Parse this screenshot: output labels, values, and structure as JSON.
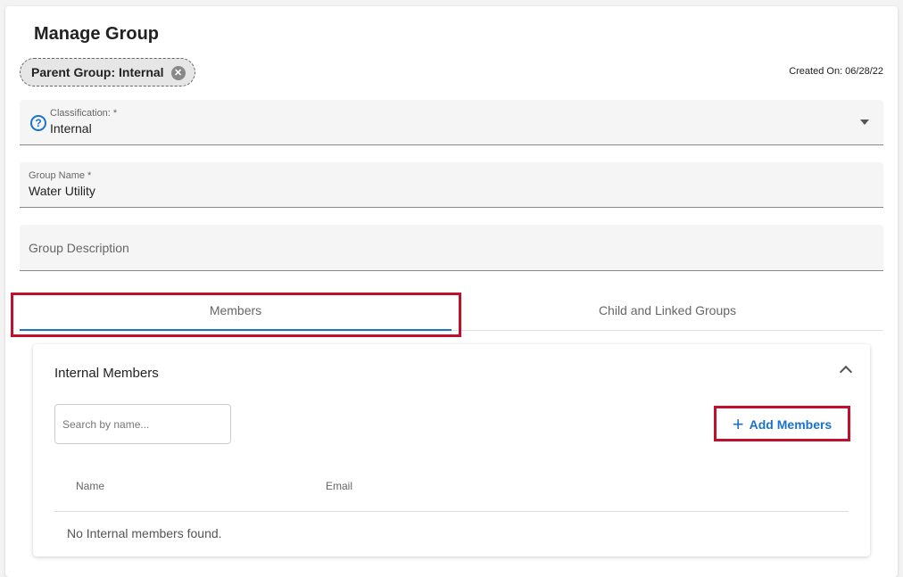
{
  "page": {
    "title": "Manage Group"
  },
  "parent_chip": {
    "label": "Parent Group: Internal",
    "close_icon": "x-circle-icon"
  },
  "meta": {
    "created_on": "Created On: 06/28/22"
  },
  "form": {
    "classification": {
      "label": "Classification: *",
      "value": "Internal",
      "help_icon": "question-circle-icon"
    },
    "group_name": {
      "label": "Group Name *",
      "value": "Water Utility"
    },
    "group_description": {
      "placeholder": "Group Description"
    }
  },
  "tabs": [
    {
      "label": "Members",
      "active": true
    },
    {
      "label": "Child and Linked Groups",
      "active": false
    }
  ],
  "members_panel": {
    "title": "Internal Members",
    "search_placeholder": "Search by name...",
    "add_button_label": "Add Members",
    "columns": [
      "Name",
      "Email"
    ],
    "empty_message": "No Internal members found."
  },
  "colors": {
    "accent": "#1a73c8",
    "highlight": "#c0102e"
  }
}
